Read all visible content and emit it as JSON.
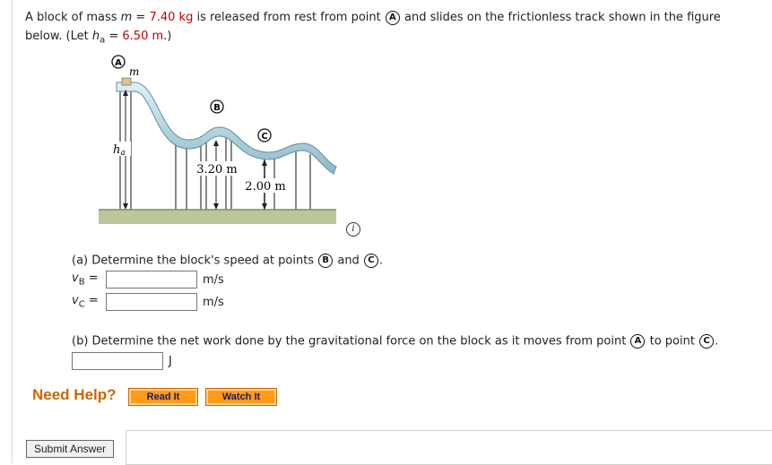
{
  "problem": {
    "t1": "A block of mass ",
    "m_var": "m",
    "t2": " = ",
    "mass": "7.40 kg",
    "t3": " is released from rest from point ",
    "pointA": "A",
    "t4": " and slides on the frictionless track shown in the figure",
    "t5": "below. (Let ",
    "h_var": "h",
    "h_sub": "a",
    "t6": " = ",
    "height": "6.50 m",
    "t7": ".)"
  },
  "figure": {
    "label_A": "A",
    "label_B": "B",
    "label_C": "C",
    "label_m": "m",
    "label_ha": "h",
    "label_ha_sub": "a",
    "label_320": "3.20 m",
    "label_200": "2.00 m"
  },
  "info_icon": "i",
  "part_a": {
    "text1": "(a) Determine the block's speed at points ",
    "pB": "B",
    "and": " and ",
    "pC": "C",
    "end": ".",
    "vB_var": "v",
    "vB_sub": "B",
    "vC_var": "v",
    "vC_sub": "C",
    "eq": " =",
    "unit": "m/s"
  },
  "part_b": {
    "text1": "(b) Determine the net work done by the gravitational force on the block as it moves from point ",
    "pA": "A",
    "to": " to point ",
    "pC": "C",
    "end": ".",
    "unit": "J"
  },
  "help": {
    "label": "Need Help?",
    "read": "Read It",
    "watch": "Watch It"
  },
  "submit": "Submit Answer"
}
